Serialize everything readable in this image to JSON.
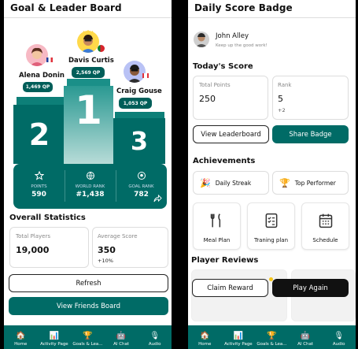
{
  "left": {
    "title": "Goal & Leader Board",
    "players": [
      {
        "name": "Alena Donin",
        "qp": "1,469 QP",
        "rank": "2"
      },
      {
        "name": "Davis Curtis",
        "qp": "2,569 QP",
        "rank": "1"
      },
      {
        "name": "Craig Gouse",
        "qp": "1,053 QP",
        "rank": "3"
      }
    ],
    "stats": [
      {
        "label": "POINTS",
        "value": "590",
        "icon": "star-icon"
      },
      {
        "label": "WORLD RANK",
        "value": "#1,438",
        "icon": "globe-icon"
      },
      {
        "label": "GOAL RANK",
        "value": "782",
        "icon": "soccer-ball-icon"
      }
    ],
    "overall_title": "Overall Statistics",
    "total_players_label": "Total Players",
    "total_players_value": "19,000",
    "avg_score_label": "Average Score",
    "avg_score_value": "350",
    "avg_score_change": "+10%",
    "refresh_label": "Refresh",
    "friends_label": "View Friends Board"
  },
  "nav_left": [
    {
      "label": "Home",
      "icon": "home-icon"
    },
    {
      "label": "Activity Page",
      "icon": "chart-icon"
    },
    {
      "label": "Goals & Lea...",
      "icon": "trophy-icon"
    },
    {
      "label": "AI Chat",
      "icon": "robot-icon"
    },
    {
      "label": "Audio",
      "icon": "mic-icon"
    }
  ],
  "right": {
    "title": "Daily Score Badge",
    "user_name": "John Alley",
    "user_sub": "Keep up the good work!",
    "today_title": "Today's Score",
    "total_points_label": "Total Points",
    "total_points_value": "250",
    "rank_label": "Rank",
    "rank_value": "5",
    "rank_change": "+2",
    "view_leaderboard": "View Leaderboard",
    "share_badge": "Share Badge",
    "achievements_title": "Achievements",
    "daily_streak": "Daily Streak",
    "top_performer": "Top Performer",
    "meal_plan": "Meal Plan",
    "training_plan": "Traning plan",
    "schedule": "Schedule",
    "reviews_title": "Player Reviews",
    "claim_reward": "Claim Reward",
    "play_again": "Play Again"
  },
  "nav_right": [
    {
      "label": "Home",
      "icon": "home-icon"
    },
    {
      "label": "Activity Page",
      "icon": "chart-icon"
    },
    {
      "label": "Goals & Lea...",
      "icon": "trophy-icon"
    },
    {
      "label": "AI Chat",
      "icon": "robot-icon"
    },
    {
      "label": "Audio",
      "icon": "mic-icon"
    }
  ],
  "colors": {
    "accent": "#006b66",
    "accent_dark": "#005e59"
  }
}
